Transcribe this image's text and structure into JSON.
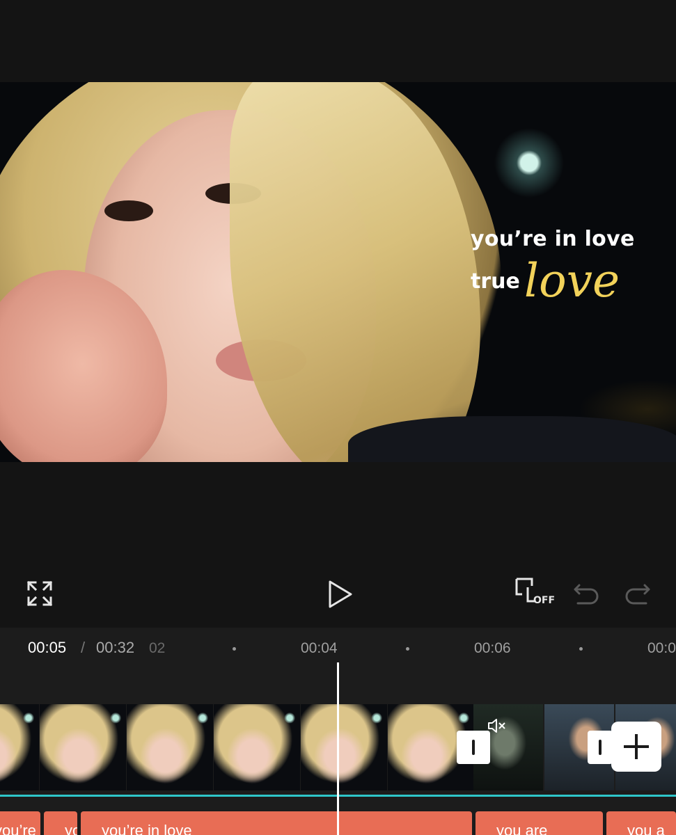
{
  "preview": {
    "caption_line1": "you’re in love",
    "caption_line2_word": "true",
    "caption_line2_script": "love"
  },
  "controls": {
    "fullscreen_icon": "fullscreen-icon",
    "play_icon": "play-icon",
    "keyframe_icon": "keyframe-off-icon",
    "keyframe_off_label": "OFF",
    "undo_icon": "undo-icon",
    "redo_icon": "redo-icon"
  },
  "timeline": {
    "current_time": "00:05",
    "separator": "/",
    "total_time": "00:32",
    "ruler_labels": [
      "02",
      "00:04",
      "00:06",
      "00:0"
    ]
  },
  "tracks": {
    "muted_icon": "mute-icon",
    "add_icon": "plus-icon",
    "text_clips": [
      "you’re",
      "yo",
      "you’re in love",
      "you are",
      "you a"
    ]
  },
  "colors": {
    "background": "#141414",
    "panel": "#1c1c1c",
    "text_clip": "#e86d55",
    "track_line": "#2ec6c9",
    "caption_script": "#f2d25a"
  }
}
